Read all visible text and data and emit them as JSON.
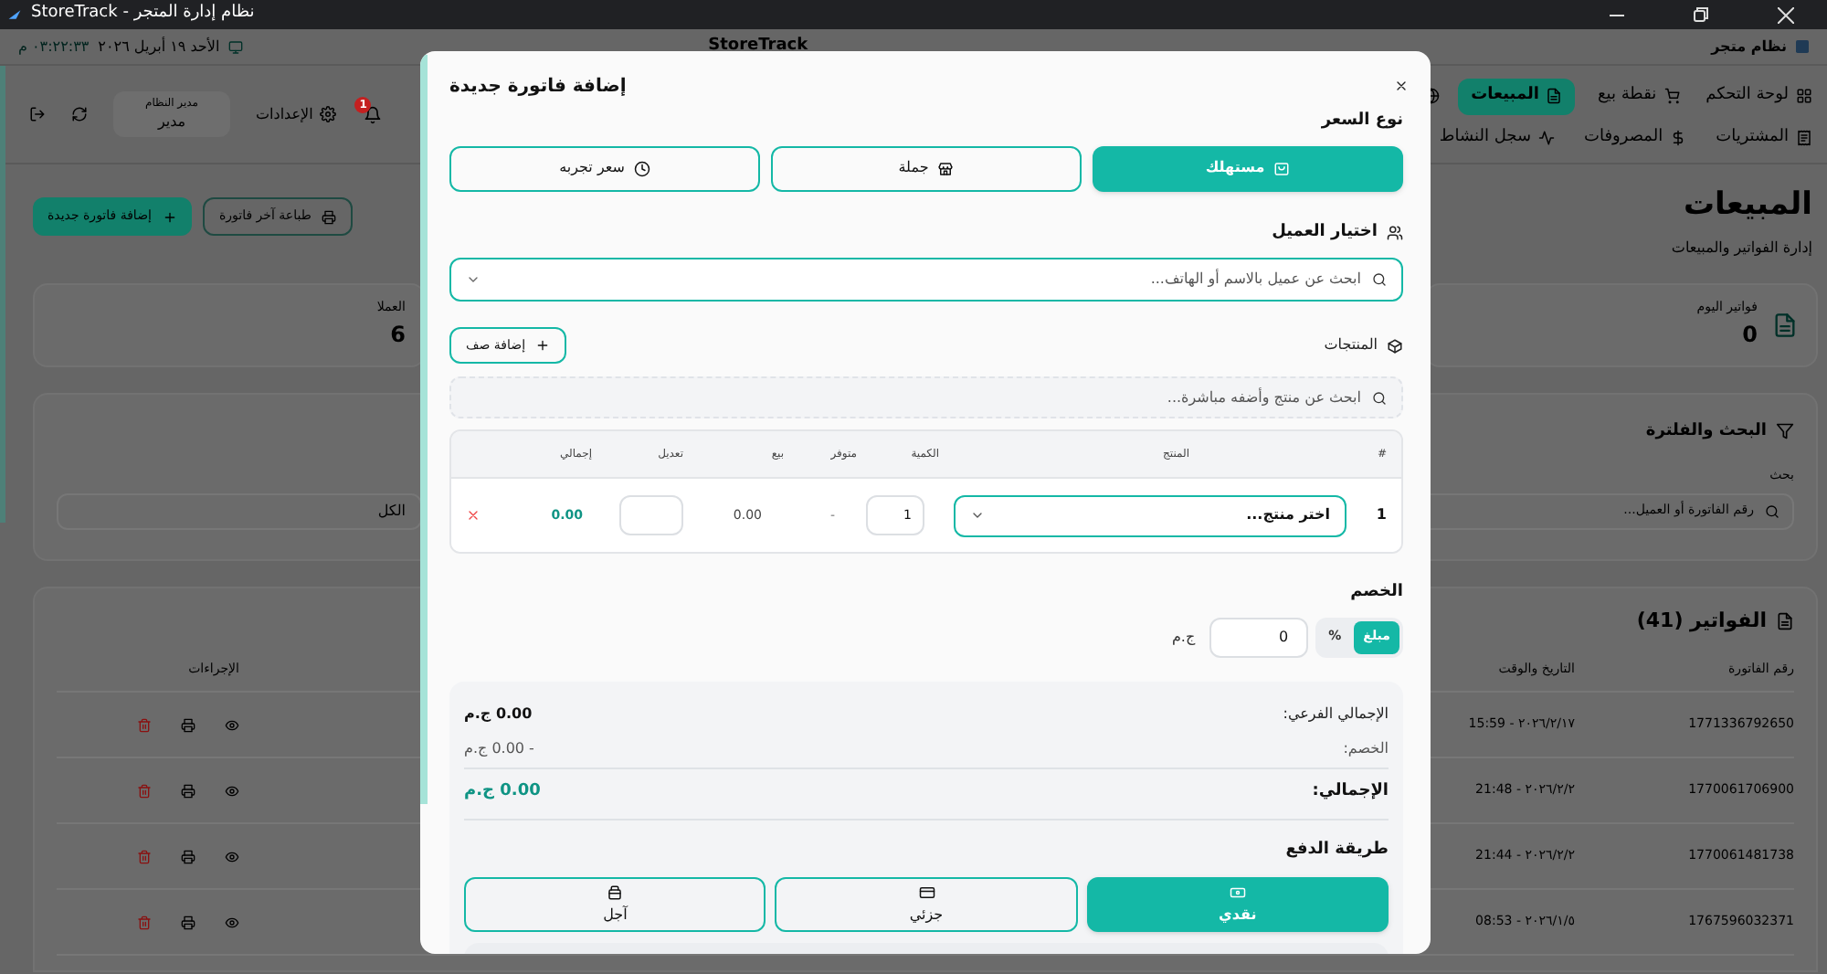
{
  "window": {
    "title": "نظام إدارة المتجر - StoreTrack"
  },
  "header": {
    "app_name": "نظام متجر",
    "logo": "StoreTrack",
    "date": "الأحد ١٩ أبريل ٢٠٢٦",
    "time": "٠٣:٢٢:٣٣ م"
  },
  "nav": [
    {
      "label": "لوحة التحكم",
      "selected": false
    },
    {
      "label": "نقطة بيع",
      "selected": false
    },
    {
      "label": "المبيعات",
      "selected": true
    },
    {
      "label": "المشتريات",
      "selected": false
    },
    {
      "label": "المصروفات",
      "selected": false
    },
    {
      "label": "سجل النشاط",
      "selected": false
    }
  ],
  "toolbar": {
    "notifications_badge": "1",
    "settings_label": "الإعدادات",
    "user_role": "مدير النظام",
    "user_name": "مدير"
  },
  "page": {
    "title": "المبيعات",
    "subtitle": "إدارة الفواتير والمبيعات"
  },
  "actions": [
    {
      "label": "طباعة آخر فاتورة",
      "kind": "outline"
    },
    {
      "label": "إضافة فاتورة جديدة",
      "kind": "primary"
    }
  ],
  "stats": [
    {
      "label": "فواتير اليوم",
      "value": "0"
    },
    {
      "label": "العملا",
      "value": "6"
    }
  ],
  "filters": {
    "title": "البحث والفلترة",
    "search_label": "بحث",
    "search_placeholder": "رقم الفاتورة أو العميل...",
    "status_value": "الكل"
  },
  "invoices": {
    "title": "الفواتير (41)",
    "columns": [
      "رقم الفاتورة",
      "التاريخ والوقت",
      "الإجراءات"
    ],
    "rows": [
      {
        "number": "1771336792650",
        "datetime": "٢٠٢٦/٢/١٧ - 15:59"
      },
      {
        "number": "1770061706900",
        "datetime": "٢٠٢٦/٢/٢ - 21:48"
      },
      {
        "number": "1770061481738",
        "datetime": "٢٠٢٦/٢/٢ - 21:44"
      },
      {
        "number": "1767596032371",
        "datetime": "٢٠٢٦/١/٥ - 08:53"
      }
    ]
  },
  "modal": {
    "title": "إضافة فاتورة جديدة",
    "price_type_label": "نوع السعر",
    "price_types": [
      {
        "label": "مستهلك",
        "selected": true
      },
      {
        "label": "جملة",
        "selected": false
      },
      {
        "label": "سعر تجربه",
        "selected": false
      }
    ],
    "customer_label": "اختيار العميل",
    "customer_placeholder": "ابحث عن عميل بالاسم أو الهاتف...",
    "products_label": "المنتجات",
    "add_row": "إضافة صف",
    "product_search_placeholder": "ابحث عن منتج وأضفه مباشرة...",
    "table": {
      "columns": [
        "#",
        "المنتج",
        "الكمية",
        "متوفر",
        "بيع",
        "تعديل",
        "إجمالي"
      ],
      "rows": [
        {
          "index": "1",
          "product_placeholder": "اختر منتج...",
          "quantity": "1",
          "available": "-",
          "sell": "0.00",
          "total": "0.00"
        }
      ]
    },
    "discount_label": "الخصم",
    "discount_modes": [
      {
        "label": "مبلغ",
        "selected": true
      },
      {
        "label": "%",
        "selected": false
      }
    ],
    "discount_value": "0",
    "currency": "ج.م",
    "summary": [
      {
        "label": "الإجمالي الفرعي:",
        "value": "0.00 ج.م",
        "kind": "subtotal"
      },
      {
        "label": "الخصم:",
        "value": "- 0.00 ج.م",
        "kind": "discount"
      },
      {
        "label": "الإجمالي:",
        "value": "0.00 ج.م",
        "kind": "total"
      }
    ],
    "payment_label": "طريقة الدفع",
    "payment_methods": [
      {
        "label": "نقدي",
        "selected": true
      },
      {
        "label": "جزئي",
        "selected": false
      },
      {
        "label": "آجل",
        "selected": false
      }
    ]
  }
}
